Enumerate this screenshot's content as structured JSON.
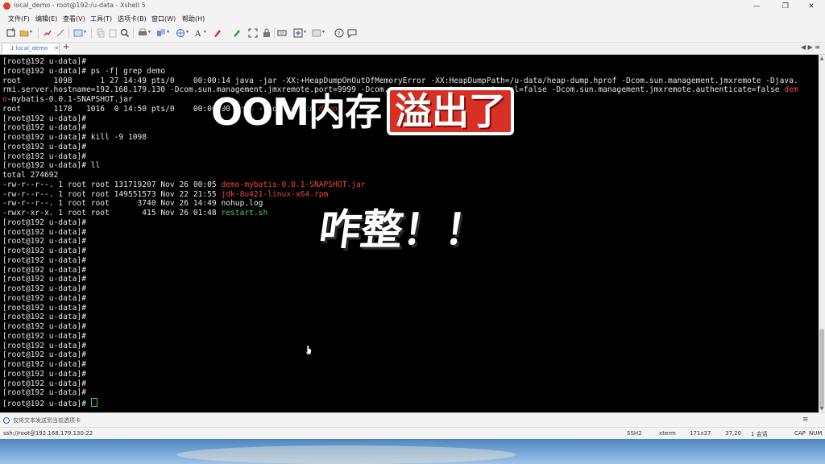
{
  "window": {
    "title": "local_demo - root@192:/u-data - Xshell 5",
    "controls": {
      "minimize": "—",
      "restore": "❐",
      "close": "✕"
    }
  },
  "menu": [
    "文件(F)",
    "编辑(E)",
    "查看(V)",
    "工具(T)",
    "选项卡(B)",
    "窗口(W)",
    "帮助(H)"
  ],
  "toolbar": {
    "icons": [
      "new-session-icon",
      "open-folder-icon",
      "reconnect-icon",
      "disconnect-icon",
      "properties-icon",
      "copy-icon",
      "paste-icon",
      "find-icon",
      "print-icon",
      "transfer-icon",
      "globe-icon",
      "font-icon",
      "color-icon",
      "fullscreen-icon",
      "lock-icon",
      "keyboard-icon",
      "script-icon",
      "layout-icon",
      "help-icon",
      "chat-icon"
    ]
  },
  "tabs": {
    "active": {
      "label": "1 local_demo",
      "close": "×"
    },
    "add": "+",
    "nav": "◀ ▶ ≡"
  },
  "terminal": {
    "lines": [
      [
        {
          "t": "[root@192 u-data]#"
        }
      ],
      [
        {
          "t": "[root@192 u-data]# ps -f| grep demo"
        }
      ],
      [
        {
          "t": "root       1098      1 27 14:49 pts/0    00:00:14 java -jar -XX:+HeapDumpOnOutOfMemoryError -XX:HeapDumpPath=/u-data/heap-dump.hprof -Dcom.sun.management.jmxremote -Djava."
        }
      ],
      [
        {
          "t": "rmi.server.hostname=192.168.179.130 -Dcom.sun.management.jmxremote.port=9999 -Dcom.sun.management.jmxremote.ssl=false -Dcom.sun.management.jmxremote.authenticate=false "
        },
        {
          "t": "dem",
          "c": "red"
        }
      ],
      [
        {
          "t": "o",
          "c": "red"
        },
        {
          "t": "-mybatis-0.0.1-SNAPSHOT.jar"
        }
      ],
      [
        {
          "t": "root       1178   1016  0 14:50 pts/0    00:00:00 grep --color=auto "
        },
        {
          "t": "demo",
          "c": "red"
        }
      ],
      [
        {
          "t": "[root@192 u-data]#"
        }
      ],
      [
        {
          "t": "[root@192 u-data]#"
        }
      ],
      [
        {
          "t": "[root@192 u-data]# kill -9 1098"
        }
      ],
      [
        {
          "t": "[root@192 u-data]#"
        }
      ],
      [
        {
          "t": "[root@192 u-data]#"
        }
      ],
      [
        {
          "t": "[root@192 u-data]# ll"
        }
      ],
      [
        {
          "t": "total 274692"
        }
      ],
      [
        {
          "t": "-rw-r--r--. 1 root root 131719207 Nov 26 00:05 "
        },
        {
          "t": "demo-mybatis-0.0.1-SNAPSHOT.jar",
          "c": "red"
        }
      ],
      [
        {
          "t": "-rw-r--r--. 1 root root 149551573 Nov 22 21:55 "
        },
        {
          "t": "jdk-8u421-linux-x64.rpm",
          "c": "red"
        }
      ],
      [
        {
          "t": "-rw-r--r--. 1 root root      3740 Nov 26 14:49 nohup.log"
        }
      ],
      [
        {
          "t": "-rwxr-xr-x. 1 root root       415 Nov 26 01:48 "
        },
        {
          "t": "restart.sh",
          "c": "green"
        }
      ],
      [
        {
          "t": "[root@192 u-data]#"
        }
      ],
      [
        {
          "t": "[root@192 u-data]#"
        }
      ],
      [
        {
          "t": "[root@192 u-data]#"
        }
      ],
      [
        {
          "t": "[root@192 u-data]#"
        }
      ],
      [
        {
          "t": "[root@192 u-data]#"
        }
      ],
      [
        {
          "t": "[root@192 u-data]#"
        }
      ],
      [
        {
          "t": "[root@192 u-data]#"
        }
      ],
      [
        {
          "t": "[root@192 u-data]#"
        }
      ],
      [
        {
          "t": "[root@192 u-data]#"
        }
      ],
      [
        {
          "t": "[root@192 u-data]#"
        }
      ],
      [
        {
          "t": "[root@192 u-data]#"
        }
      ],
      [
        {
          "t": "[root@192 u-data]#"
        }
      ],
      [
        {
          "t": "[root@192 u-data]#"
        }
      ],
      [
        {
          "t": "[root@192 u-data]#"
        }
      ],
      [
        {
          "t": "[root@192 u-data]#"
        }
      ],
      [
        {
          "t": "[root@192 u-data]#"
        }
      ],
      [
        {
          "t": "[root@192 u-data]#"
        }
      ],
      [
        {
          "t": "[root@192 u-data]#"
        }
      ],
      [
        {
          "t": "[root@192 u-data]#"
        }
      ],
      [
        {
          "t": "[root@192 u-data]# "
        }
      ]
    ]
  },
  "overlay": {
    "title_white": "OOM内存",
    "title_highlight": "溢出了",
    "exclaim": "咋整！！"
  },
  "sendbar": {
    "text": "仅将文本发送到当前选项卡",
    "menu": "≡"
  },
  "statusbar": {
    "connection": "ssh://root@192.168.179.130:22",
    "protocol": "SSH2",
    "term": "xterm",
    "size": "171x37",
    "cursor_pos": "37,20",
    "sessions": "1 会话",
    "cap": "CAP",
    "num": "NUM"
  },
  "colors": {
    "terminal_bg": "#000000",
    "error_red": "#f0463c",
    "exec_green": "#3fd34a",
    "highlight_red": "#d93025"
  }
}
